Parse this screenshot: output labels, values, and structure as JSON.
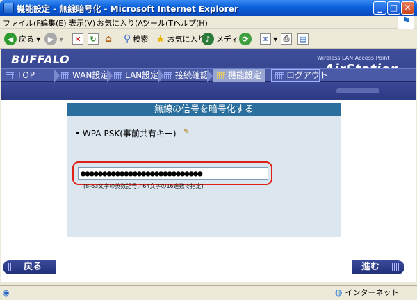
{
  "window": {
    "title": "機能設定 - 無線暗号化 - Microsoft Internet Explorer",
    "min_glyph": "_",
    "max_glyph": "□",
    "close_glyph": "✕"
  },
  "menubar": {
    "items": [
      "ファイル(F)",
      "編集(E)",
      "表示(V)",
      "お気に入り(A)",
      "ツール(T)",
      "ヘルプ(H)"
    ]
  },
  "toolbar": {
    "back_label": "戻る",
    "search_label": "検索",
    "favorites_label": "お気に入り",
    "media_label": "メディア"
  },
  "header": {
    "logo": "BUFFALO",
    "product_caption": "Wireless LAN Access Point",
    "product_name": "AirStation"
  },
  "nav": {
    "tabs": [
      "TOP",
      "WAN設定",
      "LAN設定",
      "接続確認",
      "機能設定",
      "ログアウト"
    ],
    "active_tab": "機能設定"
  },
  "panel": {
    "title": "無線の信号を暗号化する",
    "option_label": "WPA-PSK(事前共有キー)",
    "key_value": "●●●●●●●●●●●●●●●●●●●●●●●●●●●●",
    "hint": "(8-63文字の英数記号／64文字の16進数で指定)"
  },
  "buttons": {
    "back_label": "戻る",
    "next_label": "進む"
  },
  "statusbar": {
    "zone": "インターネット"
  },
  "colors": {
    "panel_bg": "#dce6ef",
    "panel_title_bg": "#2a6f9e",
    "header_bg": "#2e3c86",
    "highlight_ring": "#e0211a"
  }
}
